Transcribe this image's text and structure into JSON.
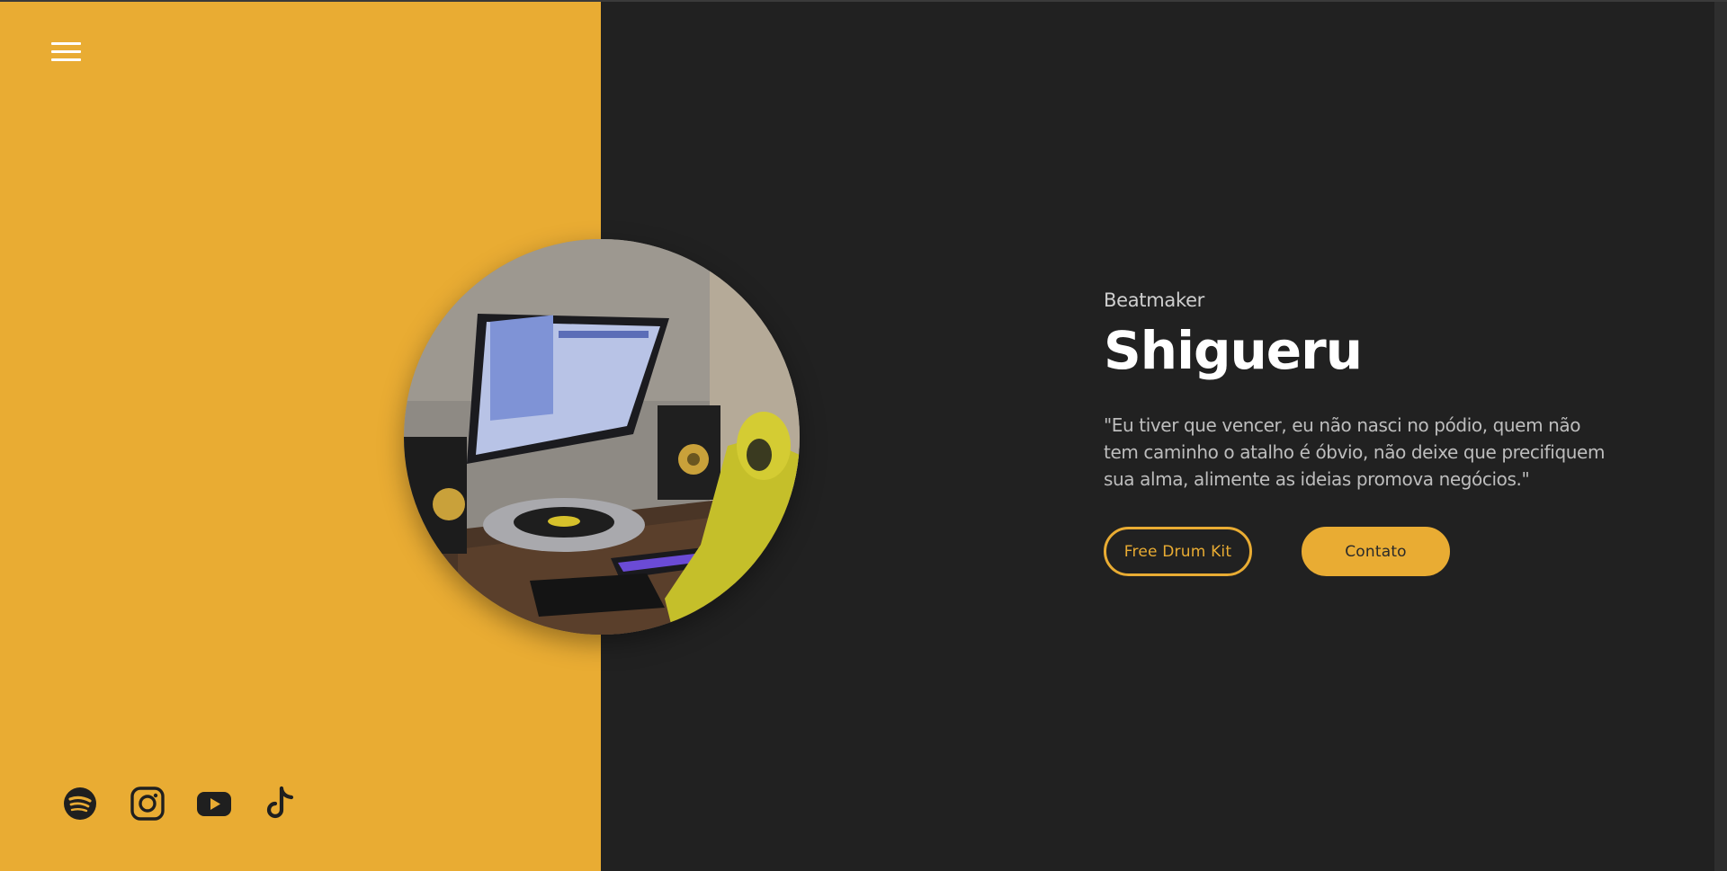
{
  "colors": {
    "accent": "#e9ac33",
    "dark_background": "#212121",
    "text_light": "#ffffff",
    "text_muted": "#bdbdbd"
  },
  "nav": {
    "menu_icon": "hamburger-menu-icon"
  },
  "hero": {
    "subtitle": "Beatmaker",
    "title": "Shigueru",
    "quote": "\"Eu tiver que vencer, eu não nasci no pódio, quem não tem caminho o atalho é óbvio, não deixe que precifiquem sua alma, alimente as ideias promova negócios.\"",
    "primary_button": "Free Drum Kit",
    "secondary_button": "Contato"
  },
  "socials": [
    {
      "icon": "spotify-icon"
    },
    {
      "icon": "instagram-icon"
    },
    {
      "icon": "youtube-icon"
    },
    {
      "icon": "tiktok-icon"
    }
  ]
}
